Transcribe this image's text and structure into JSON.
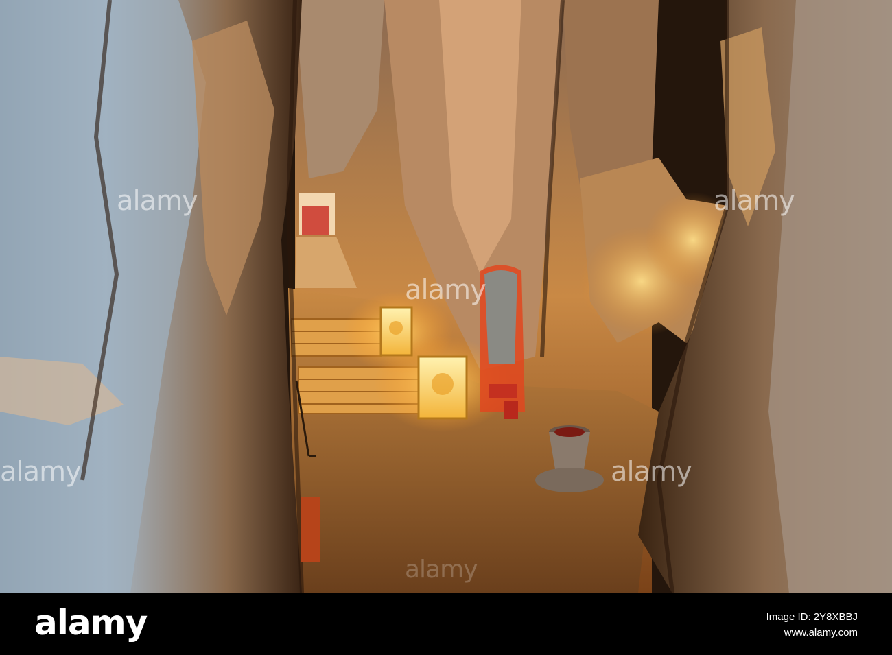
{
  "photo": {
    "subject": "illuminated-cave-temple-interior",
    "colors": {
      "rock_warm": "#c7782a",
      "rock_cool": "#a4b4c4",
      "light_glow": "#ffc24a",
      "shrine_red": "#d8341c",
      "floor": "#b5793a",
      "deep_shadow": "#1a0f08"
    }
  },
  "watermark": {
    "text": "alamy"
  },
  "footer": {
    "logo": "alamy",
    "image_id_label": "Image ID: 2Y8XBBJ",
    "site": "www.alamy.com"
  }
}
